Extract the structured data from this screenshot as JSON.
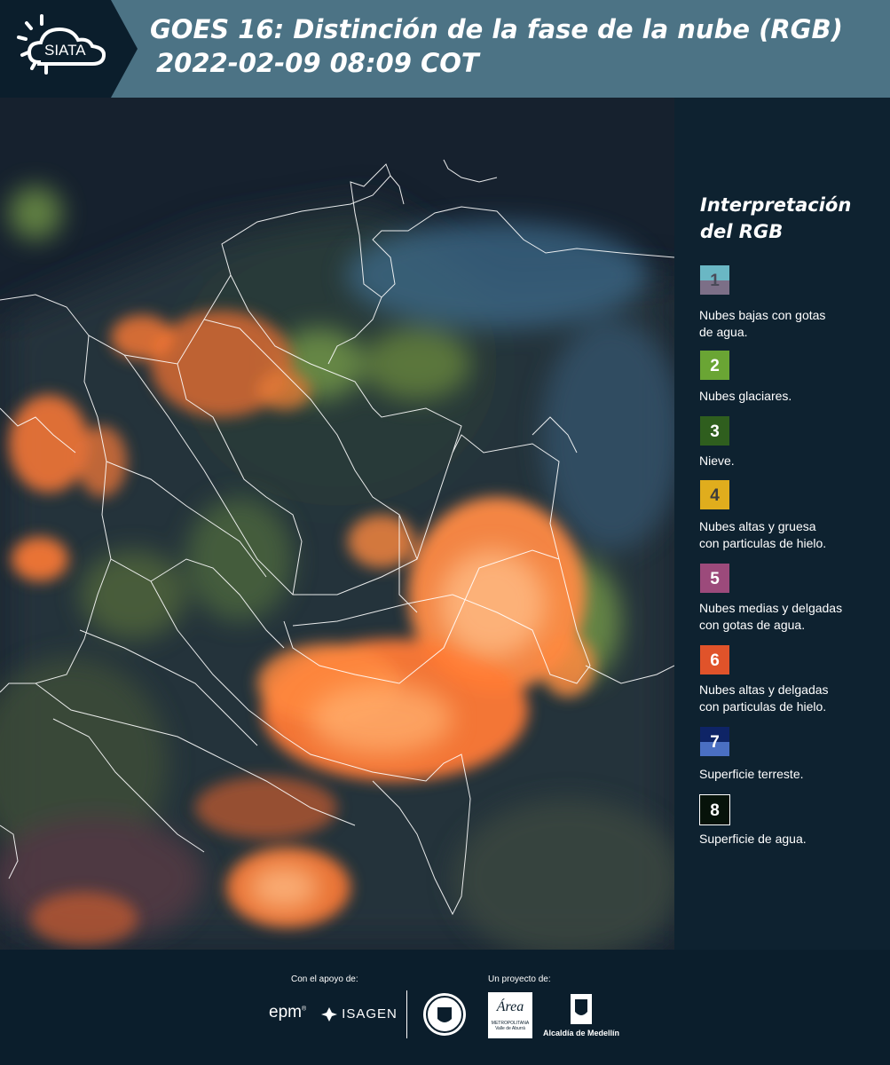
{
  "header": {
    "logo_text": "SIATA",
    "title_line1": "GOES 16: Distinción de la fase de la nube (RGB)",
    "title_line2": "2022-02-09 08:09 COT"
  },
  "legend": {
    "title_line1": "Interpretación",
    "title_line2": "del RGB",
    "items": [
      {
        "number": "1",
        "color_top": "#6ab7c4",
        "color_bottom": "#7c6f87",
        "number_color": "#4a4a58",
        "label_line1": "Nubes bajas con gotas",
        "label_line2": "de agua."
      },
      {
        "number": "2",
        "color_top": "#6aa534",
        "color_bottom": "#6aa534",
        "number_color": "#ffffff",
        "label_line1": "Nubes glaciares.",
        "label_line2": ""
      },
      {
        "number": "3",
        "color_top": "#2f5e1e",
        "color_bottom": "#2f5e1e",
        "number_color": "#ffffff",
        "label_line1": "Nieve.",
        "label_line2": ""
      },
      {
        "number": "4",
        "color_top": "#e0ad1d",
        "color_bottom": "#e0ad1d",
        "number_color": "#3c3c3c",
        "label_line1": "Nubes altas y gruesa",
        "label_line2": "con particulas de hielo."
      },
      {
        "number": "5",
        "color_top": "#9c4a7b",
        "color_bottom": "#9c4a7b",
        "number_color": "#ffffff",
        "label_line1": "Nubes medias y delgadas",
        "label_line2": "con gotas de agua."
      },
      {
        "number": "6",
        "color_top": "#e0532a",
        "color_bottom": "#e0532a",
        "number_color": "#ffffff",
        "label_line1": "Nubes altas y delgadas",
        "label_line2": "con particulas de hielo."
      },
      {
        "number": "7",
        "color_top": "#0e2466",
        "color_bottom": "#4a6fc2",
        "number_color": "#ffffff",
        "label_line1": "Superficie terreste.",
        "label_line2": ""
      },
      {
        "number": "8",
        "color_top": "#07130a",
        "color_bottom": "#07130a",
        "number_color": "#ffffff",
        "label_line1": "Superficie de agua.",
        "label_line2": ""
      }
    ]
  },
  "footer": {
    "support_label": "Con el apoyo de:",
    "project_label": "Un proyecto de:",
    "sponsor1": "epm",
    "sponsor2": "ISAGEN",
    "partner_amva": "Área",
    "partner_amva_sub1": "METROPOLITANA",
    "partner_amva_sub2": "Valle de Aburrá",
    "partner_medellin": "Alcaldía de Medellín"
  },
  "map": {
    "alt": "satellite RGB composite",
    "colors": {
      "ocean": "#16212e",
      "land": "#26343a",
      "cloud_orange": "#ff7a35",
      "cloud_green": "#7aa04a",
      "cloud_blue": "#3d6a8a",
      "border": "#ffffff"
    }
  }
}
